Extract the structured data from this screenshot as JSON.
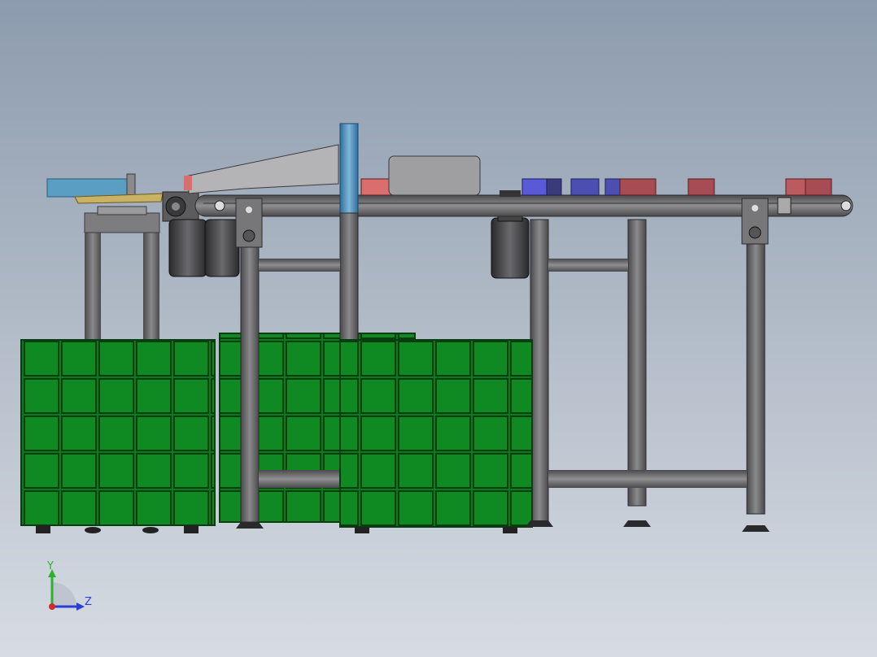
{
  "triad": {
    "y_label": "Y",
    "z_label": "Z",
    "y_color": "#2fb02f",
    "z_color": "#2a3fd6",
    "x_color": "#d42a2a"
  },
  "colors": {
    "background_top": "#8c9bae",
    "background_bottom": "#d7dce3",
    "pallet_green": "#0b7a1c",
    "pallet_grid": "#0a3d12",
    "frame_gray": "#6e6e70",
    "frame_dark": "#3b3b3d",
    "box_red": "#b95b5f",
    "box_blue": "#4d4fb0",
    "pusher_blue": "#4a8bb8"
  }
}
